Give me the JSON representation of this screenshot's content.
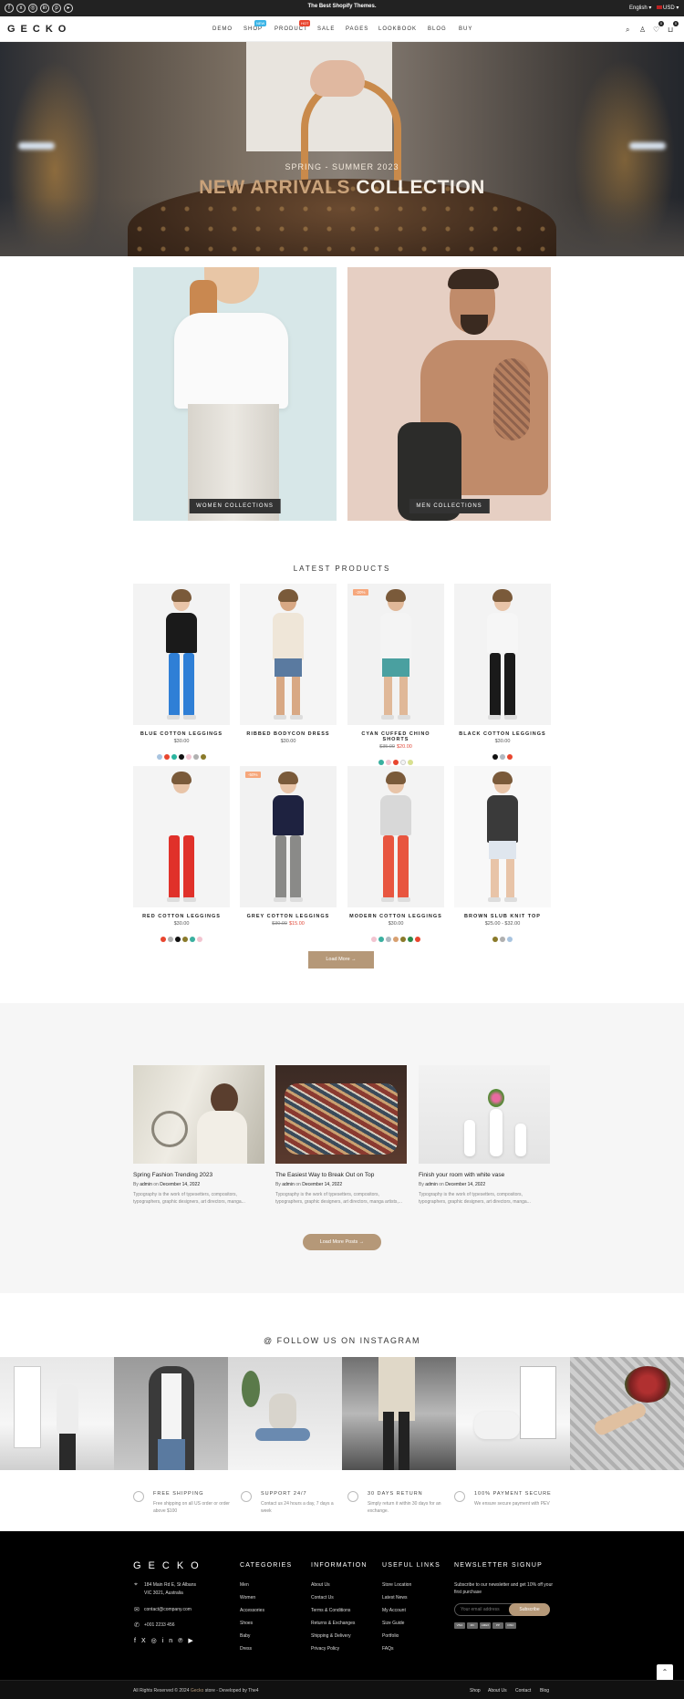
{
  "topbar": {
    "promo": "The Best Shopify Themes.",
    "language": "English",
    "currency": "USD",
    "social_icons": [
      "facebook-icon",
      "x-icon",
      "instagram-icon",
      "linkedin-icon",
      "pinterest-icon",
      "youtube-icon"
    ]
  },
  "header": {
    "logo": "GECKO",
    "nav": [
      {
        "label": "DEMO",
        "badge": ""
      },
      {
        "label": "SHOP",
        "badge": "NEW",
        "badge_color": "#3bb4e6"
      },
      {
        "label": "PRODUCT",
        "badge": "HOT",
        "badge_color": "#e8462f"
      },
      {
        "label": "SALE",
        "badge": ""
      },
      {
        "label": "PAGES",
        "badge": ""
      },
      {
        "label": "LOOKBOOK",
        "badge": ""
      },
      {
        "label": "BLOG",
        "badge": ""
      },
      {
        "label": "BUY",
        "badge": ""
      }
    ],
    "wishlist_count": "0",
    "cart_count": "0"
  },
  "hero": {
    "subtitle": "SPRING - SUMMER 2023",
    "title_part1": "NEW ARRIVALS",
    "title_part2": "COLLECTION",
    "slides": 3,
    "active_slide": 2
  },
  "collections": [
    {
      "label": "WOMEN COLLECTIONS"
    },
    {
      "label": "MEN COLLECTIONS"
    }
  ],
  "products_section": {
    "title": "LATEST PRODUCTS",
    "load_more": "Load More",
    "items": [
      {
        "name": "BLUE COTTON LEGGINGS",
        "price": "$30.00",
        "old_price": "",
        "sale_price": "",
        "badge": "",
        "swatches": [
          "#a8c4e0",
          "#e8462f",
          "#2bb5a0",
          "#111111",
          "#f2c4d0",
          "#b0b0b0",
          "#8a7a2a"
        ]
      },
      {
        "name": "RIBBED BODYCON DRESS",
        "price": "$30.00",
        "old_price": "",
        "sale_price": "",
        "badge": "",
        "swatches": []
      },
      {
        "name": "CYAN CUFFED CHINO SHORTS",
        "price": "",
        "old_price": "$35.00",
        "sale_price": "$20.00",
        "badge": "-20%",
        "swatches": [
          "#3ab0a0",
          "#f2c4d0",
          "#e8462f",
          "#f4f4f4",
          "#d8e090"
        ]
      },
      {
        "name": "BLACK COTTON LEGGINGS",
        "price": "$30.00",
        "old_price": "",
        "sale_price": "",
        "badge": "",
        "swatches": [
          "#111111",
          "#b0b8c0",
          "#e8462f"
        ]
      },
      {
        "name": "RED COTTON LEGGINGS",
        "price": "$30.00",
        "old_price": "",
        "sale_price": "",
        "badge": "",
        "swatches": [
          "#e8462f",
          "#b0b0b0",
          "#111111",
          "#8a7a2a",
          "#3ab0a0",
          "#f2c4d0"
        ]
      },
      {
        "name": "GREY COTTON LEGGINGS",
        "price": "",
        "old_price": "$30.00",
        "sale_price": "$15.00",
        "badge": "-50%",
        "swatches": []
      },
      {
        "name": "MODERN COTTON LEGGINGS",
        "price": "$30.00",
        "old_price": "",
        "sale_price": "",
        "badge": "",
        "swatches": [
          "#f2c4d0",
          "#3ab0a0",
          "#b0b8c0",
          "#d8a070",
          "#8a7a2a",
          "#2a8a4a",
          "#e8462f"
        ]
      },
      {
        "name": "BROWN SLUB KNIT TOP",
        "price": "$25.00 - $32.00",
        "old_price": "",
        "sale_price": "",
        "badge": "",
        "swatches": [
          "#8a7a2a",
          "#b0b0b0",
          "#a8c4e0"
        ]
      }
    ]
  },
  "blog": {
    "load_more": "Load More Posts",
    "posts": [
      {
        "title": "Spring Fashion Trending 2023",
        "by": "By",
        "author": "admin",
        "on": "on",
        "date": "December 14, 2022",
        "excerpt": "Typography is the work of typesetters, compositors, typographers, graphic designers, art directors, manga..."
      },
      {
        "title": "The Easiest Way to Break Out on Top",
        "by": "By",
        "author": "admin",
        "on": "on",
        "date": "December 14, 2022",
        "excerpt": "Typography is the work of typesetters, compositors, typographers, graphic designers, art directors, manga artists,..."
      },
      {
        "title": "Finish your room with white vase",
        "by": "By",
        "author": "admin",
        "on": "on",
        "date": "December 14, 2022",
        "excerpt": "Typography is the work of typesetters, compositors, typographers, graphic designers, art directors, manga..."
      }
    ]
  },
  "instagram": {
    "title": "@ FOLLOW US ON INSTAGRAM"
  },
  "features": [
    {
      "icon": "truck-icon",
      "title": "FREE SHIPPING",
      "desc": "Free shipping on all US order or order above $100"
    },
    {
      "icon": "support-icon",
      "title": "SUPPORT 24/7",
      "desc": "Contact us 24 hours a day, 7 days a week"
    },
    {
      "icon": "return-icon",
      "title": "30 DAYS RETURN",
      "desc": "Simply return it within 30 days for an exchange."
    },
    {
      "icon": "secure-icon",
      "title": "100% PAYMENT SECURE",
      "desc": "We ensure secure payment with PEV"
    }
  ],
  "footer": {
    "logo": "GECKO",
    "address_line1": "184 Main Rd E, St Albans",
    "address_line2": "VIC 3021, Australia",
    "email": "contact@company.com",
    "phone": "+001 2233 456",
    "categories_title": "CATEGORIES",
    "categories": [
      "Men",
      "Women",
      "Accessories",
      "Shoes",
      "Baby",
      "Dress"
    ],
    "information_title": "INFORMATION",
    "information": [
      "About Us",
      "Contact Us",
      "Terms & Conditions",
      "Returns & Exchanges",
      "Shipping & Delivery",
      "Privacy Policy"
    ],
    "useful_title": "USEFUL LINKS",
    "useful": [
      "Store Location",
      "Latest News",
      "My Account",
      "Size Guide",
      "Portfolio",
      "FAQs"
    ],
    "newsletter_title": "NEWSLETTER SIGNUP",
    "newsletter_text": "Subscribe to our newsletter and get 10% off your first purchase",
    "email_placeholder": "Your email address",
    "subscribe": "Subscribe",
    "payments": [
      "VISA",
      "MC",
      "AMEX",
      "PP",
      "DISC"
    ],
    "copyright_pre": "All Rights Reserved © 2024",
    "copyright_brand": "Gecko",
    "copyright_post": "store - Developed by The4",
    "bottom_links": [
      "Shop",
      "About Us",
      "Contact",
      "Blog"
    ]
  },
  "colors": {
    "accent": "#b59878",
    "sale_red": "#e04a3a",
    "badge_peach": "#f6a77c",
    "footer_bg": "#000000"
  }
}
